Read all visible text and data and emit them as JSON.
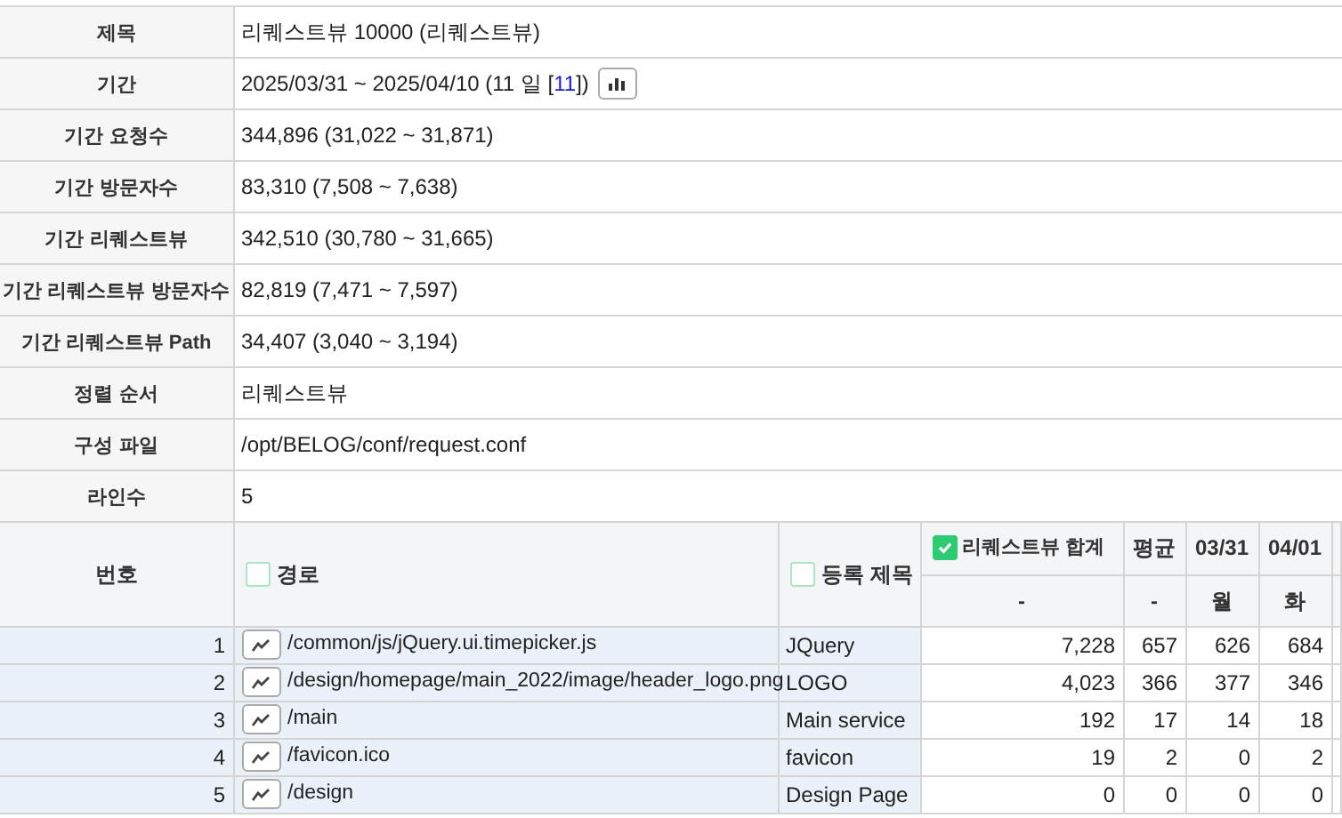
{
  "info": [
    {
      "kind": "text",
      "label": "제목",
      "value": "리퀘스트뷰 10000 (리퀘스트뷰)"
    },
    {
      "kind": "period",
      "label": "기간",
      "value": "2025/03/31 ~ 2025/04/10 (11 일 [",
      "link": "11",
      "value_after": "])"
    },
    {
      "kind": "text",
      "label": "기간 요청수",
      "value": "344,896 (31,022 ~ 31,871)"
    },
    {
      "kind": "text",
      "label": "기간 방문자수",
      "value": "83,310 (7,508 ~ 7,638)"
    },
    {
      "kind": "text",
      "label": "기간 리퀘스트뷰",
      "value": "342,510 (30,780 ~ 31,665)"
    },
    {
      "kind": "text",
      "label": "기간 리퀘스트뷰 방문자수",
      "value": "82,819 (7,471 ~ 7,597)"
    },
    {
      "kind": "text",
      "label": "기간 리퀘스트뷰 Path",
      "value": "34,407 (3,040 ~ 3,194)"
    },
    {
      "kind": "text",
      "label": "정렬 순서",
      "value": "리퀘스트뷰"
    },
    {
      "kind": "text",
      "label": "구성 파일",
      "value": "/opt/BELOG/conf/request.conf"
    },
    {
      "kind": "text",
      "label": "라인수",
      "value": "5"
    }
  ],
  "table": {
    "number_header": "번호",
    "path_header": {
      "label": "경로",
      "checked": false
    },
    "title_header": {
      "label": "등록 제목",
      "checked": false
    },
    "total_header": {
      "label": "리퀘스트뷰 합계",
      "checked": true,
      "sub": "-"
    },
    "average_header": {
      "label": "평균",
      "sub": "-"
    },
    "day_headers": [
      {
        "date": "03/31",
        "day": "월"
      },
      {
        "date": "04/01",
        "day": "화"
      }
    ],
    "rows": [
      {
        "number": "1",
        "path": "/common/js/jQuery.ui.timepicker.js",
        "title": "JQuery",
        "total": "7,228",
        "average": "657",
        "days": [
          "626",
          "684"
        ]
      },
      {
        "number": "2",
        "path": "/design/homepage/main_2022/image/header_logo.png",
        "title": "LOGO",
        "total": "4,023",
        "average": "366",
        "days": [
          "377",
          "346"
        ]
      },
      {
        "number": "3",
        "path": "/main",
        "title": "Main service",
        "total": "192",
        "average": "17",
        "days": [
          "14",
          "18"
        ]
      },
      {
        "number": "4",
        "path": "/favicon.ico",
        "title": "favicon",
        "total": "19",
        "average": "2",
        "days": [
          "0",
          "2"
        ]
      },
      {
        "number": "5",
        "path": "/design",
        "title": "Design Page",
        "total": "0",
        "average": "0",
        "days": [
          "0",
          "0"
        ]
      }
    ]
  }
}
